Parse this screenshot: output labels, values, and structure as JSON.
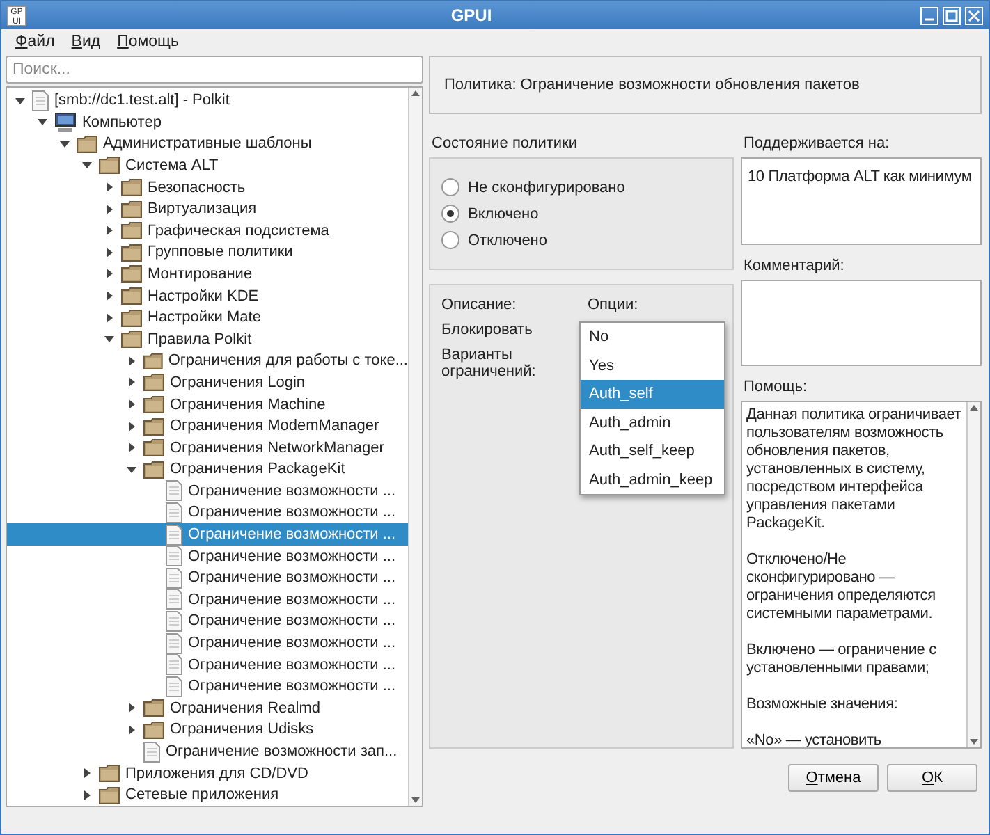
{
  "window": {
    "title": "GPUI",
    "app_icon": "GP UI"
  },
  "menu": [
    {
      "label": "Файл"
    },
    {
      "label": "Вид"
    },
    {
      "label": "Помощь"
    }
  ],
  "search": {
    "placeholder": "Поиск..."
  },
  "tree": [
    {
      "label": "[smb://dc1.test.alt] - Polkit",
      "kind": "document",
      "expanded": true,
      "selected": false,
      "children": [
        {
          "label": "Компьютер",
          "kind": "computer",
          "expanded": true,
          "selected": false,
          "children": [
            {
              "label": "Административные шаблоны",
              "kind": "folder",
              "expanded": true,
              "selected": false,
              "children": [
                {
                  "label": "Система ALT",
                  "kind": "folder",
                  "expanded": true,
                  "selected": false,
                  "children": [
                    {
                      "label": "Безопасность",
                      "kind": "folder",
                      "expanded": false,
                      "selected": false
                    },
                    {
                      "label": "Виртуализация",
                      "kind": "folder",
                      "expanded": false,
                      "selected": false
                    },
                    {
                      "label": "Графическая подсистема",
                      "kind": "folder",
                      "expanded": false,
                      "selected": false
                    },
                    {
                      "label": "Групповые политики",
                      "kind": "folder",
                      "expanded": false,
                      "selected": false
                    },
                    {
                      "label": "Монтирование",
                      "kind": "folder",
                      "expanded": false,
                      "selected": false
                    },
                    {
                      "label": "Настройки KDE",
                      "kind": "folder",
                      "expanded": false,
                      "selected": false
                    },
                    {
                      "label": "Настройки Mate",
                      "kind": "folder",
                      "expanded": false,
                      "selected": false
                    },
                    {
                      "label": "Правила Polkit",
                      "kind": "folder",
                      "expanded": true,
                      "selected": false,
                      "children": [
                        {
                          "label": "Ограничения для работы с токе...",
                          "kind": "folder",
                          "expanded": false,
                          "selected": false
                        },
                        {
                          "label": "Ограничения Login",
                          "kind": "folder",
                          "expanded": false,
                          "selected": false
                        },
                        {
                          "label": "Ограничения Machine",
                          "kind": "folder",
                          "expanded": false,
                          "selected": false
                        },
                        {
                          "label": "Ограничения ModemManager",
                          "kind": "folder",
                          "expanded": false,
                          "selected": false
                        },
                        {
                          "label": "Ограничения NetworkManager",
                          "kind": "folder",
                          "expanded": false,
                          "selected": false
                        },
                        {
                          "label": "Ограничения PackageKit",
                          "kind": "folder",
                          "expanded": true,
                          "selected": false,
                          "children": [
                            {
                              "label": "Ограничение возможности ...",
                              "kind": "document",
                              "selected": false
                            },
                            {
                              "label": "Ограничение возможности ...",
                              "kind": "document",
                              "selected": false
                            },
                            {
                              "label": "Ограничение возможности ...",
                              "kind": "document",
                              "selected": true
                            },
                            {
                              "label": "Ограничение возможности ...",
                              "kind": "document",
                              "selected": false
                            },
                            {
                              "label": "Ограничение возможности ...",
                              "kind": "document",
                              "selected": false
                            },
                            {
                              "label": "Ограничение возможности ...",
                              "kind": "document",
                              "selected": false
                            },
                            {
                              "label": "Ограничение возможности ...",
                              "kind": "document",
                              "selected": false
                            },
                            {
                              "label": "Ограничение возможности ...",
                              "kind": "document",
                              "selected": false
                            },
                            {
                              "label": "Ограничение возможности ...",
                              "kind": "document",
                              "selected": false
                            },
                            {
                              "label": "Ограничение возможности ...",
                              "kind": "document",
                              "selected": false
                            }
                          ]
                        },
                        {
                          "label": "Ограничения Realmd",
                          "kind": "folder",
                          "expanded": false,
                          "selected": false
                        },
                        {
                          "label": "Ограничения Udisks",
                          "kind": "folder",
                          "expanded": false,
                          "selected": false
                        },
                        {
                          "label": "Ограничение возможности зап...",
                          "kind": "document",
                          "selected": false
                        }
                      ]
                    }
                  ]
                },
                {
                  "label": "Приложения для CD/DVD",
                  "kind": "folder",
                  "expanded": false,
                  "selected": false
                },
                {
                  "label": "Сетевые приложения",
                  "kind": "folder",
                  "expanded": false,
                  "selected": false
                }
              ]
            }
          ]
        }
      ]
    }
  ],
  "policy": {
    "title": "Политика: Ограничение возможности обновления пакетов"
  },
  "state": {
    "label": "Состояние политики",
    "options": [
      {
        "label": "Не сконфигурировано",
        "selected": false
      },
      {
        "label": "Включено",
        "selected": true
      },
      {
        "label": "Отключено",
        "selected": false
      }
    ]
  },
  "options_panel": {
    "description_label": "Описание:",
    "options_label": "Опции:",
    "fields": [
      {
        "label": "Блокировать"
      },
      {
        "label": "Варианты ограничений:"
      }
    ]
  },
  "dropdown": {
    "items": [
      {
        "label": "No",
        "selected": false
      },
      {
        "label": "Yes",
        "selected": false
      },
      {
        "label": "Auth_self",
        "selected": true
      },
      {
        "label": "Auth_admin",
        "selected": false
      },
      {
        "label": "Auth_self_keep",
        "selected": false
      },
      {
        "label": "Auth_admin_keep",
        "selected": false
      }
    ]
  },
  "supported": {
    "label": "Поддерживается на:",
    "value": "10 Платформа ALT как минимум"
  },
  "comment": {
    "label": "Комментарий:"
  },
  "help": {
    "label": "Помощь:",
    "paragraphs": [
      "Данная политика ограничивает пользователям возможность обновления пакетов, установленных в систему, посредством интерфейса управления пакетами PackageKit.",
      "Отключено/Не сконфигурировано — ограничения определяются системными параметрами.",
      "Включено — ограничение с установленными правами;",
      "Возможные значения:",
      "«No» — установить"
    ]
  },
  "buttons": [
    {
      "label": "Отмена"
    },
    {
      "label": "ОК"
    }
  ]
}
